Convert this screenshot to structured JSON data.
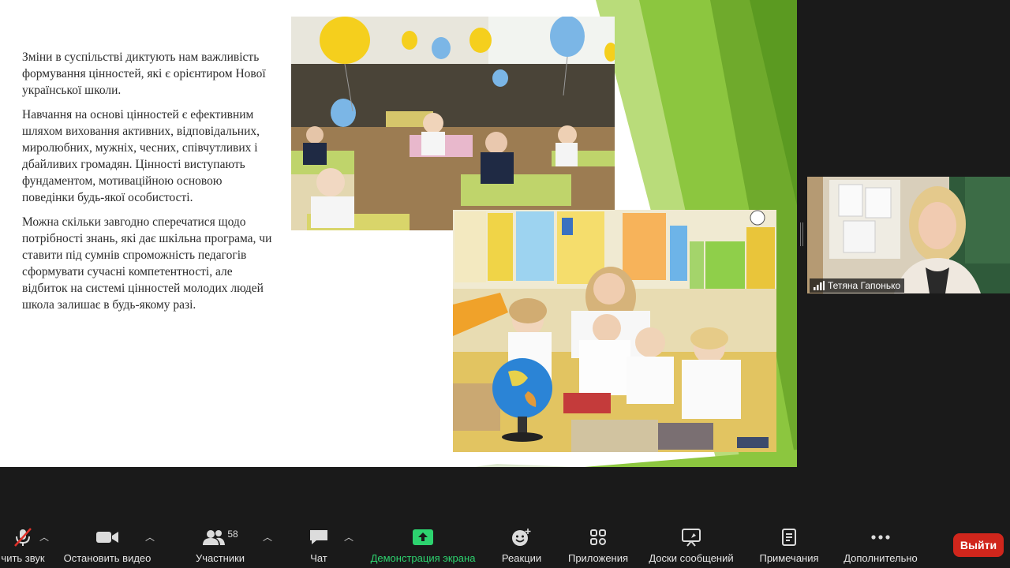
{
  "slide": {
    "paragraphs": [
      "Зміни в суспільстві диктують нам важливість формування цінностей, які є орієнтиром Нової української школи.",
      "Навчання на основі цінностей є ефективним шляхом виховання активних, відповідальних, миролюбних, мужніх, чесних, співчутливих і дбайливих громадян. Цінності виступають фундаментом, мотиваційною основою поведінки будь-якої особистості.",
      "Можна скільки завгодно сперечатися щодо потрібності знань, які дає шкільна програма, чи ставити під сумнів спроможність педагогів сформувати сучасні компетентності, але відбиток на системі цінностей молодих людей школа залишає в будь-якому разі."
    ]
  },
  "participant": {
    "name": "Тетяна Гапонько"
  },
  "toolbar": {
    "mute_label": "чить звук",
    "video_label": "Остановить видео",
    "participants_label": "Участники",
    "participants_count": "58",
    "chat_label": "Чат",
    "share_label": "Демонстрация экрана",
    "reactions_label": "Реакции",
    "apps_label": "Приложения",
    "whiteboards_label": "Доски сообщений",
    "notes_label": "Примечания",
    "more_label": "Дополнительно",
    "leave_label": "Выйти"
  },
  "colors": {
    "share_green": "#2dd36f",
    "leave_red": "#d0261c",
    "slide_green": "#8cc63f"
  }
}
